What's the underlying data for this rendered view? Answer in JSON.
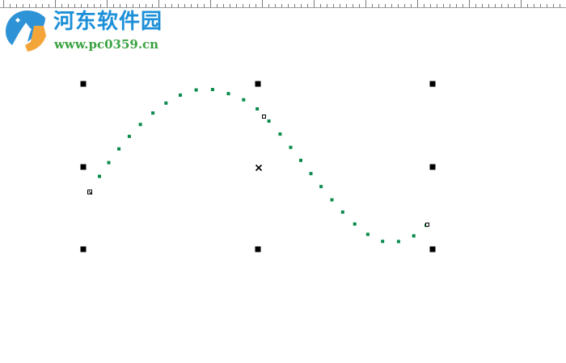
{
  "watermark": {
    "title": "河东软件园",
    "url": "www.pc0359.cn",
    "logo_icon": "leaf-logo-icon",
    "title_color": "#1b8fd8",
    "url_color": "#3aa241"
  },
  "canvas": {
    "curve_color": "#0a8a4a",
    "handle_color": "#000000",
    "selected_object": "dotted-s-curve",
    "icons": [
      "selection-handle",
      "center-x-icon",
      "node-icon"
    ]
  }
}
